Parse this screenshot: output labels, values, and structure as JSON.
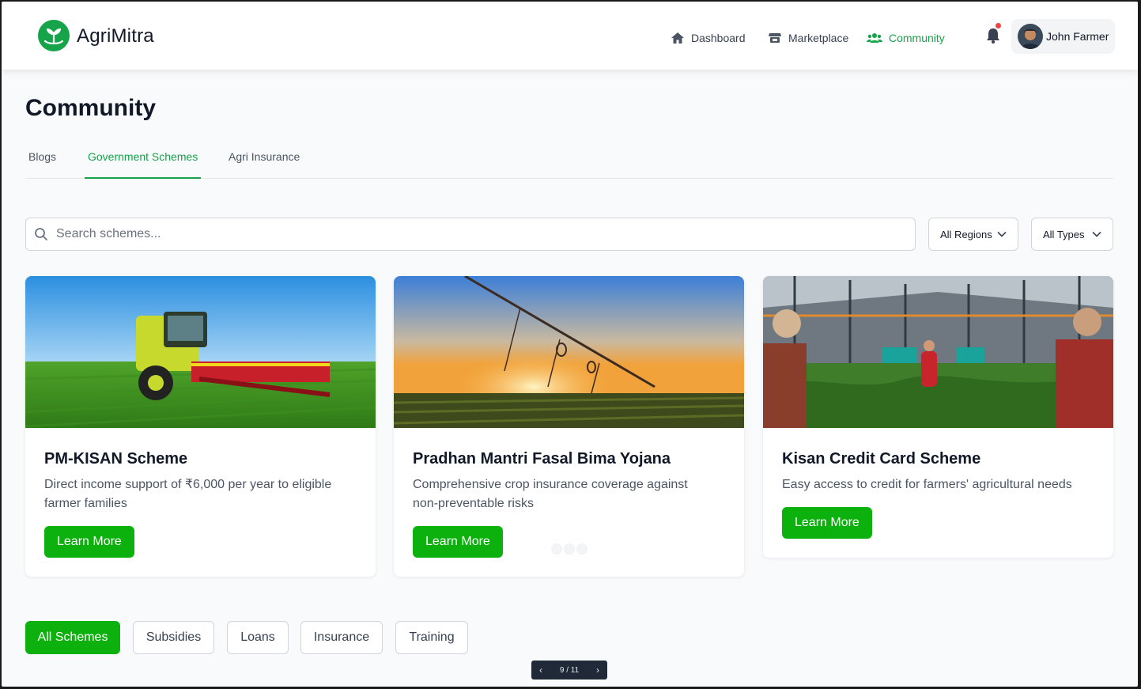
{
  "app": {
    "name": "AgriMitra"
  },
  "nav": {
    "items": [
      {
        "label": "Dashboard",
        "icon": "home-icon"
      },
      {
        "label": "Marketplace",
        "icon": "store-icon"
      },
      {
        "label": "Community",
        "icon": "users-icon",
        "active": true
      }
    ]
  },
  "user": {
    "name": "John Farmer",
    "has_notification": true
  },
  "page": {
    "title": "Community"
  },
  "tabs": [
    {
      "label": "Blogs"
    },
    {
      "label": "Government Schemes",
      "active": true
    },
    {
      "label": "Agri Insurance"
    }
  ],
  "search": {
    "placeholder": "Search schemes...",
    "value": ""
  },
  "filters": {
    "region": "All Regions",
    "type": "All Types"
  },
  "schemes": [
    {
      "title": "PM-KISAN Scheme",
      "description": "Direct income support of ₹6,000 per year to eligible farmer families",
      "button": "Learn More",
      "image": "harvester-in-field"
    },
    {
      "title": "Pradhan Mantri Fasal Bima Yojana",
      "description": "Comprehensive crop insurance coverage against non-preventable risks",
      "button": "Learn More",
      "image": "irrigation-sunset"
    },
    {
      "title": "Kisan Credit Card Scheme",
      "description": "Easy access to credit for farmers' agricultural needs",
      "button": "Learn More",
      "image": "greenhouse-training"
    }
  ],
  "categories": [
    {
      "label": "All Schemes",
      "active": true
    },
    {
      "label": "Subsidies"
    },
    {
      "label": "Loans"
    },
    {
      "label": "Insurance"
    },
    {
      "label": "Training"
    }
  ],
  "pager": {
    "text": "9 / 11"
  },
  "colors": {
    "accent": "#16a34a",
    "button": "#0db10d",
    "notification": "#ef4444"
  }
}
